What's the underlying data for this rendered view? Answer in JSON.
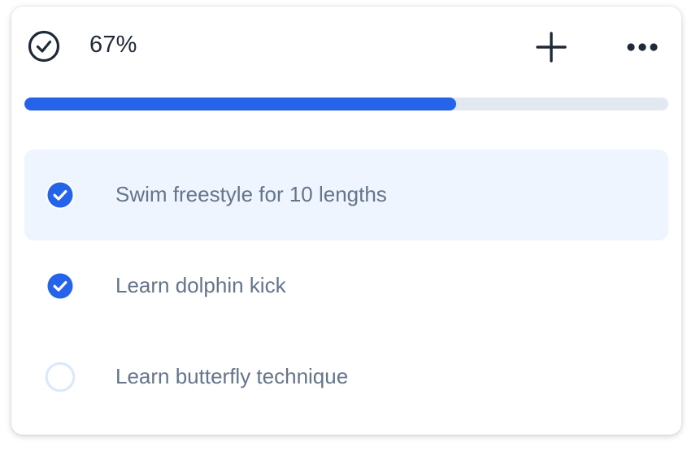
{
  "header": {
    "progress_text": "67%",
    "progress_fraction": 0.67,
    "status_icon": "check-circle-icon",
    "add_icon": "plus-icon",
    "more_icon": "more-horizontal-icon"
  },
  "tasks": [
    {
      "label": "Swim freestyle for 10 lengths",
      "done": true,
      "highlighted": true
    },
    {
      "label": "Learn dolphin kick",
      "done": true,
      "highlighted": false
    },
    {
      "label": "Learn butterfly technique",
      "done": false,
      "highlighted": false
    }
  ],
  "colors": {
    "accent": "#2563eb",
    "track": "#e2e8f0",
    "highlight": "#eef5ff",
    "text_primary": "#1f2937",
    "text_secondary": "#64748b",
    "unchecked_border": "#dbe7fb"
  }
}
